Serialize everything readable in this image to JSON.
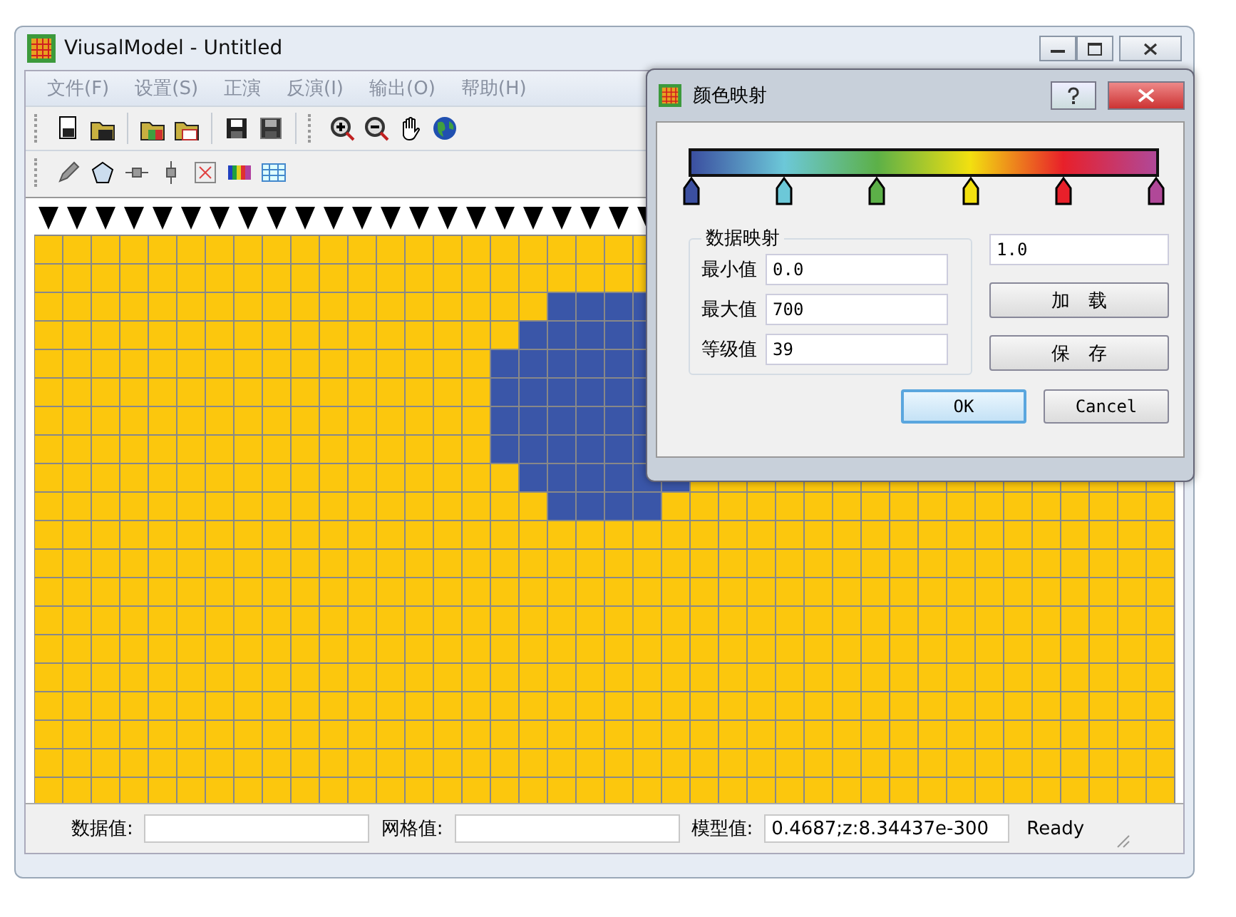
{
  "window": {
    "title": "ViusalModel - Untitled"
  },
  "menu": [
    {
      "label": "文件(F)"
    },
    {
      "label": "设置(S)"
    },
    {
      "label": "正演"
    },
    {
      "label": "反演(I)"
    },
    {
      "label": "输出(O)"
    },
    {
      "label": "帮助(H)"
    }
  ],
  "status_bar": {
    "fields": [
      {
        "label": "数据值:"
      },
      {
        "label": "网格值:"
      },
      {
        "label": "模型值:",
        "value": "0.4687;z:8.34437e-300"
      }
    ],
    "status": "Ready"
  },
  "dialog": {
    "title": "颜色映射",
    "color_stops": [
      {
        "color": "#3b4fa0"
      },
      {
        "color": "#6cc8d8"
      },
      {
        "color": "#5cb048"
      },
      {
        "color": "#f2e010"
      },
      {
        "color": "#e8202a"
      },
      {
        "color": "#b04898"
      }
    ],
    "group_title": "数据映射",
    "fields": [
      {
        "label": "最小值",
        "value": "0.0"
      },
      {
        "label": "最大值",
        "value": "700"
      },
      {
        "label": "等级值",
        "value": "39"
      }
    ],
    "side_value": "1.0",
    "side_buttons": [
      {
        "label": "加　载"
      },
      {
        "label": "保　存"
      }
    ],
    "buttons": [
      {
        "label": "OK",
        "kind": "default"
      },
      {
        "label": "Cancel",
        "kind": "normal"
      }
    ]
  }
}
